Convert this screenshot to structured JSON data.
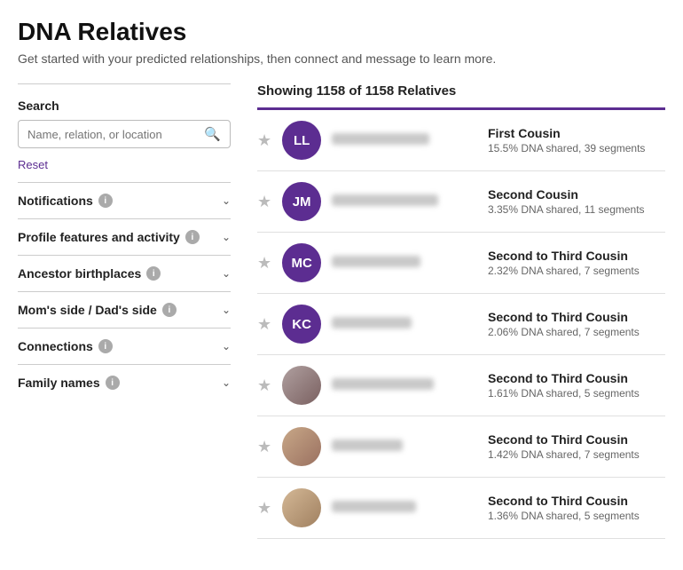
{
  "page": {
    "title": "DNA Relatives",
    "subtitle": "Get started with your predicted relationships, then connect and message to learn more."
  },
  "sidebar": {
    "search": {
      "label": "Search",
      "placeholder": "Name, relation, or location"
    },
    "reset_label": "Reset",
    "sections": [
      {
        "id": "notifications",
        "label": "Notifications",
        "has_info": true
      },
      {
        "id": "profile",
        "label": "Profile features and activity",
        "has_info": true
      },
      {
        "id": "ancestor",
        "label": "Ancestor birthplaces",
        "has_info": true
      },
      {
        "id": "sides",
        "label": "Mom's side / Dad's side",
        "has_info": true
      },
      {
        "id": "connections",
        "label": "Connections",
        "has_info": true
      },
      {
        "id": "family",
        "label": "Family names",
        "has_info": true
      }
    ]
  },
  "content": {
    "showing_label": "Showing 1158 of 1158 Relatives",
    "relatives": [
      {
        "id": 1,
        "initials": "LL",
        "type": "initials",
        "name_width": 110,
        "relation": "First Cousin",
        "dna": "15.5% DNA shared, 39 segments"
      },
      {
        "id": 2,
        "initials": "JM",
        "type": "initials",
        "name_width": 120,
        "relation": "Second Cousin",
        "dna": "3.35% DNA shared, 11 segments"
      },
      {
        "id": 3,
        "initials": "MC",
        "type": "initials",
        "name_width": 100,
        "relation": "Second to Third Cousin",
        "dna": "2.32% DNA shared, 7 segments"
      },
      {
        "id": 4,
        "initials": "KC",
        "type": "initials",
        "name_width": 90,
        "relation": "Second to Third Cousin",
        "dna": "2.06% DNA shared, 7 segments"
      },
      {
        "id": 5,
        "initials": "",
        "type": "photo1",
        "name_width": 115,
        "relation": "Second to Third Cousin",
        "dna": "1.61% DNA shared, 5 segments"
      },
      {
        "id": 6,
        "initials": "",
        "type": "photo2",
        "name_width": 80,
        "relation": "Second to Third Cousin",
        "dna": "1.42% DNA shared, 7 segments"
      },
      {
        "id": 7,
        "initials": "",
        "type": "photo3",
        "name_width": 95,
        "relation": "Second to Third Cousin",
        "dna": "1.36% DNA shared, 5 segments"
      }
    ]
  },
  "icons": {
    "search": "🔍",
    "chevron": "∨",
    "star_empty": "☆",
    "info": "i"
  }
}
